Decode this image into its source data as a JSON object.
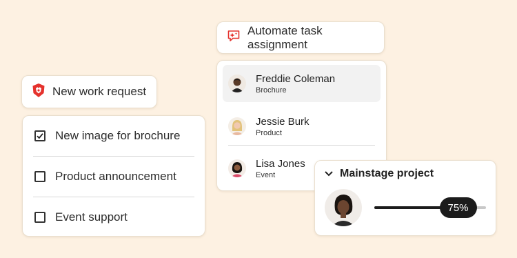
{
  "work_request": {
    "label": "New work request",
    "icon": "adobe-workfront-icon",
    "icon_color": "#e5322d"
  },
  "checklist": {
    "items": [
      {
        "label": "New image for brochure",
        "checked": true
      },
      {
        "label": "Product announcement",
        "checked": false
      },
      {
        "label": "Event support",
        "checked": false
      }
    ]
  },
  "automate": {
    "label": "Automate task assignment",
    "icon": "sparkle-chat-icon",
    "icon_color": "#e5322d"
  },
  "people": [
    {
      "name": "Freddie Coleman",
      "role": "Brochure",
      "selected": true
    },
    {
      "name": "Jessie Burk",
      "role": "Product",
      "selected": false
    },
    {
      "name": "Lisa Jones",
      "role": "Event",
      "selected": false
    }
  ],
  "project": {
    "title": "Mainstage project",
    "progress": 0.75,
    "progress_label": "75%"
  }
}
